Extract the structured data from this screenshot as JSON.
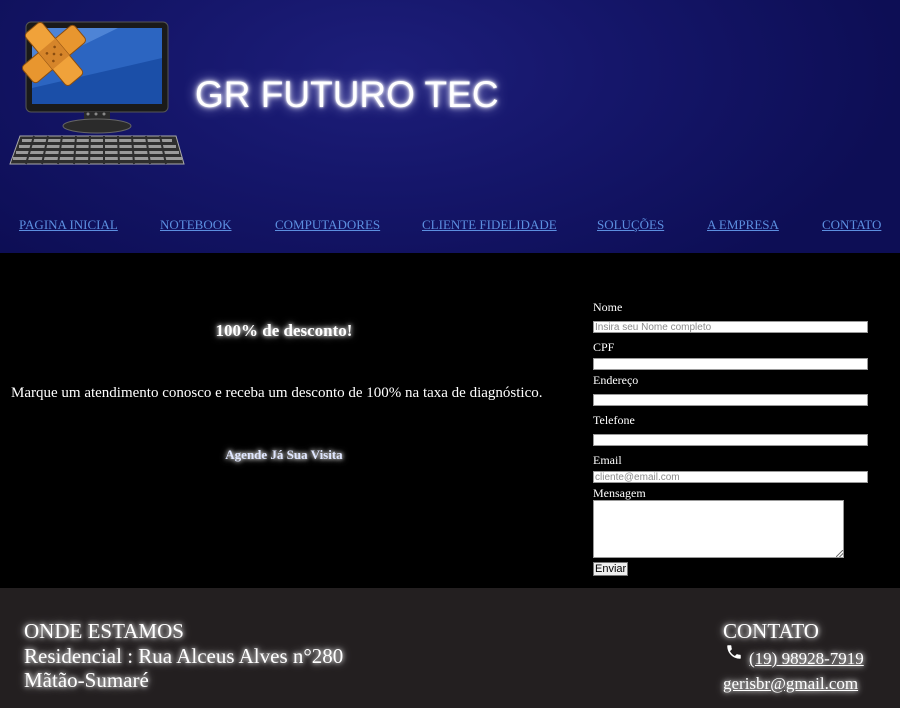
{
  "header": {
    "logo_icon": "computer-repair-icon",
    "title": "GR FUTURO TEC"
  },
  "nav": {
    "items": [
      {
        "label": "PAGINA INICIAL"
      },
      {
        "label": "NOTEBOOK"
      },
      {
        "label": "COMPUTADORES"
      },
      {
        "label": "CLIENTE FIDELIDADE"
      },
      {
        "label": "SOLUÇÕES"
      },
      {
        "label": "A EMPRESA"
      },
      {
        "label": "CONTATO"
      }
    ]
  },
  "promo": {
    "title": "100% de desconto!",
    "text": "Marque um atendimento conosco e receba um desconto de 100% na taxa de diagnóstico.",
    "cta": "Agende Já Sua Visita"
  },
  "form": {
    "name_label": "Nome",
    "name_placeholder": "Insira seu Nome completo",
    "cpf_label": "CPF",
    "address_label": "Endereço",
    "phone_label": "Telefone",
    "email_label": "Email",
    "email_placeholder": "cliente@email.com",
    "message_label": "Mensagem",
    "submit_label": "Enviar"
  },
  "footer": {
    "location_title": "ONDE ESTAMOS",
    "address_line1": "Residencial : Rua Alceus Alves n°280",
    "address_line2": "Mãtão-Sumaré",
    "contact_title": "CONTATO",
    "phone_icon": "phone-icon",
    "phone": "(19) 98928-7919",
    "email": "gerisbr@gmail.com"
  },
  "colors": {
    "header_bg": "#15166a",
    "nav_link": "#5c8fe0",
    "main_bg": "#000000",
    "footer_bg": "#231f20"
  }
}
